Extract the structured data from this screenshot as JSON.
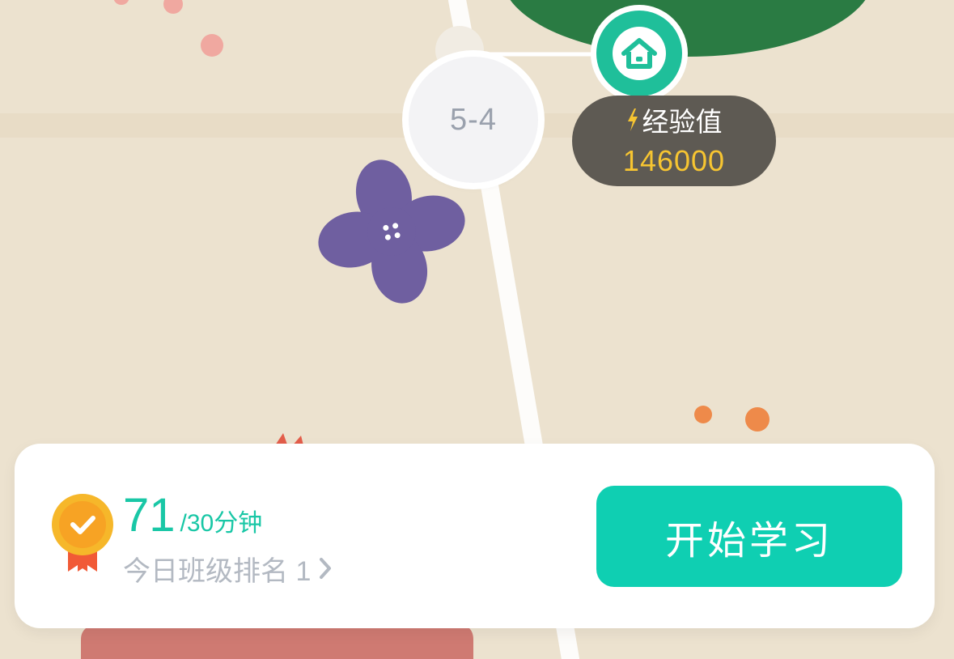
{
  "map": {
    "level_label": "5-4",
    "home_icon": "house-icon"
  },
  "experience": {
    "icon": "lightning-icon",
    "label": "经验值",
    "value": "146000"
  },
  "study_card": {
    "medal_icon": "medal-check-icon",
    "study_minutes": "71",
    "goal_separator": "/",
    "goal_text": "30分钟",
    "rank_text": "今日班级排名 1",
    "rank_chevron_icon": "chevron-right-icon",
    "start_button_label": "开始学习"
  },
  "colors": {
    "accent": "#0fcfb2",
    "badge_bg": "#5e5a53",
    "badge_value": "#f7c531",
    "flower": "#6f5fa0"
  }
}
